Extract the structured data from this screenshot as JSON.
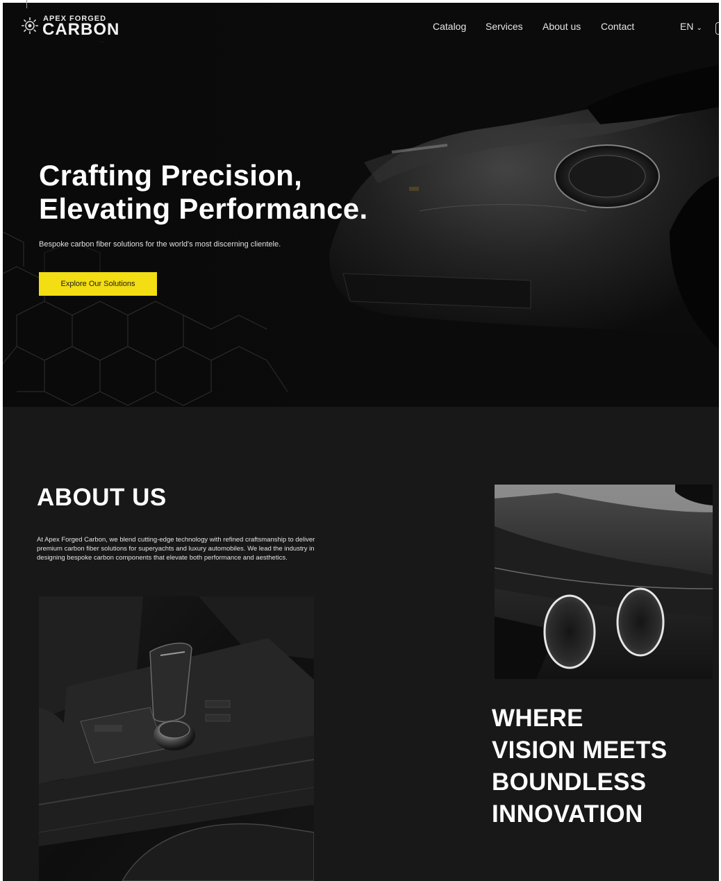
{
  "brand": {
    "name_top": "APEX FORGED",
    "name_main": "CARBON"
  },
  "nav": {
    "items": [
      {
        "label": "Catalog"
      },
      {
        "label": "Services"
      },
      {
        "label": "About us"
      },
      {
        "label": "Contact"
      }
    ],
    "language": "EN"
  },
  "hero": {
    "title_line1": "Crafting Precision,",
    "title_line2": "Elevating Performance.",
    "subtitle": "Bespoke carbon fiber solutions for the world's most discerning clientele.",
    "cta_label": "Explore Our Solutions"
  },
  "about": {
    "title": "ABOUT US",
    "body": "At Apex Forged Carbon, we blend cutting-edge technology with refined craftsmanship to deliver premium carbon fiber solutions for superyachts and luxury automobiles. We lead the industry in designing bespoke carbon components that elevate both performance and aesthetics.",
    "tagline_lines": [
      "WHERE",
      "VISION MEETS",
      "BOUNDLESS",
      "INNOVATION"
    ]
  },
  "colors": {
    "accent": "#f3dd13",
    "background": "#181818",
    "text": "#ffffff"
  },
  "icons": {
    "logo": "carbon-gear-logo-icon",
    "language_dropdown": "chevron-down-icon",
    "partial_right_edge": "partial-icon"
  }
}
